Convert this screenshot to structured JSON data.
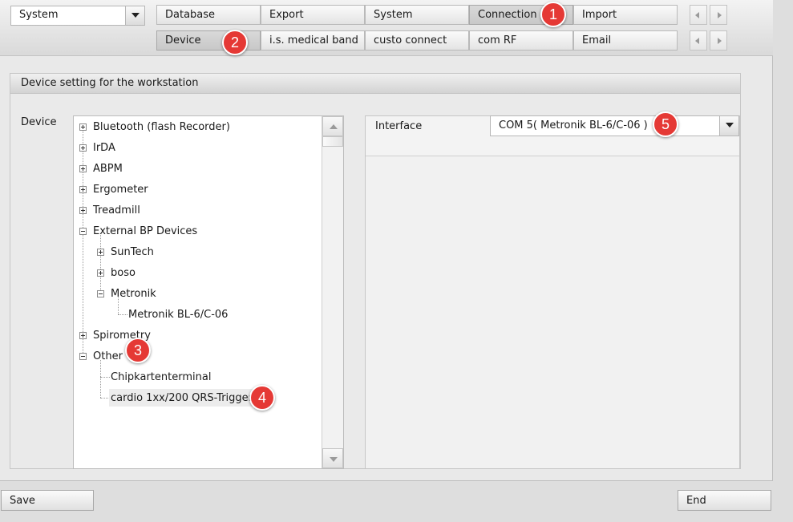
{
  "top": {
    "module_select": {
      "value": "System"
    },
    "tabs_row1": [
      "Database",
      "Export",
      "System",
      "Connection",
      "Import"
    ],
    "tabs_row2": [
      "Device",
      "i.s. medical band",
      "custo connect",
      "com RF",
      "Email"
    ],
    "selected_row1": "Connection",
    "selected_row2": "Device"
  },
  "panel": {
    "title": "Device setting for the workstation",
    "device_label": "Device",
    "tree": {
      "bluetooth": "Bluetooth (flash Recorder)",
      "irda": "IrDA",
      "abpm": "ABPM",
      "ergometer": "Ergometer",
      "treadmill": "Treadmill",
      "external_bp": "External BP Devices",
      "suntech": "SunTech",
      "boso": "boso",
      "metronik": "Metronik",
      "metronik_model": "Metronik BL-6/C-06",
      "spirometry": "Spirometry",
      "other": "Other",
      "chipkarten": "Chipkartenterminal",
      "cardio": "cardio 1xx/200 QRS-Trigger"
    },
    "selected_node": "cardio 1xx/200 QRS-Trigger",
    "interface_label": "Interface",
    "interface_value": "COM 5( Metronik BL-6/C-06 )"
  },
  "callouts": [
    "1",
    "2",
    "3",
    "4",
    "5"
  ],
  "footer": {
    "save_label": "Save",
    "end_label": "End"
  },
  "colors": {
    "callout": "#e53935",
    "selected_row": "#ececec"
  }
}
